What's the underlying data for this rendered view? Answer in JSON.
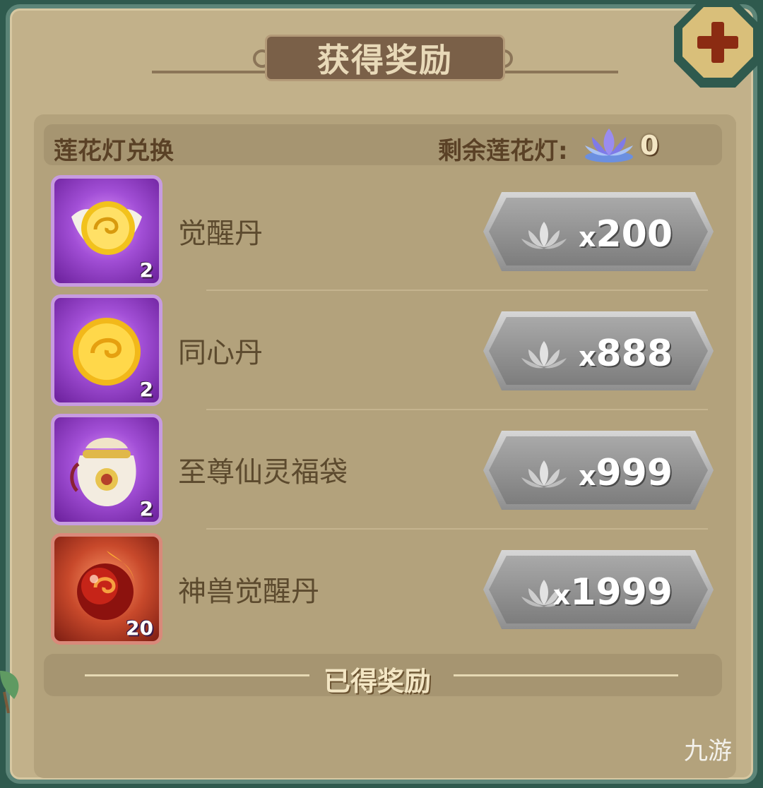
{
  "title": "获得奖励",
  "header": {
    "left_label": "莲花灯兑换",
    "remaining_label": "剩余莲花灯:",
    "remaining_count": "0"
  },
  "items": [
    {
      "name": "觉醒丹",
      "qty": "2",
      "price_x": "x",
      "price": "200",
      "rarity": "purple",
      "icon": "golden-swirl-orb-winged-icon"
    },
    {
      "name": "同心丹",
      "qty": "2",
      "price_x": "x",
      "price": "888",
      "rarity": "purple",
      "icon": "golden-swirl-orb-icon"
    },
    {
      "name": "至尊仙灵福袋",
      "qty": "2",
      "price_x": "x",
      "price": "999",
      "rarity": "purple",
      "icon": "lucky-bag-icon"
    },
    {
      "name": "神兽觉醒丹",
      "qty": "20",
      "price_x": "x",
      "price": "1999",
      "rarity": "red",
      "icon": "fire-orb-icon"
    }
  ],
  "footer": {
    "label": "已得奖励"
  },
  "watermark": "九游",
  "colors": {
    "panel": "#c2b18a",
    "frame": "#2f5a4e",
    "text_brown": "#5c4a2e",
    "plus": "#8b2b12"
  }
}
